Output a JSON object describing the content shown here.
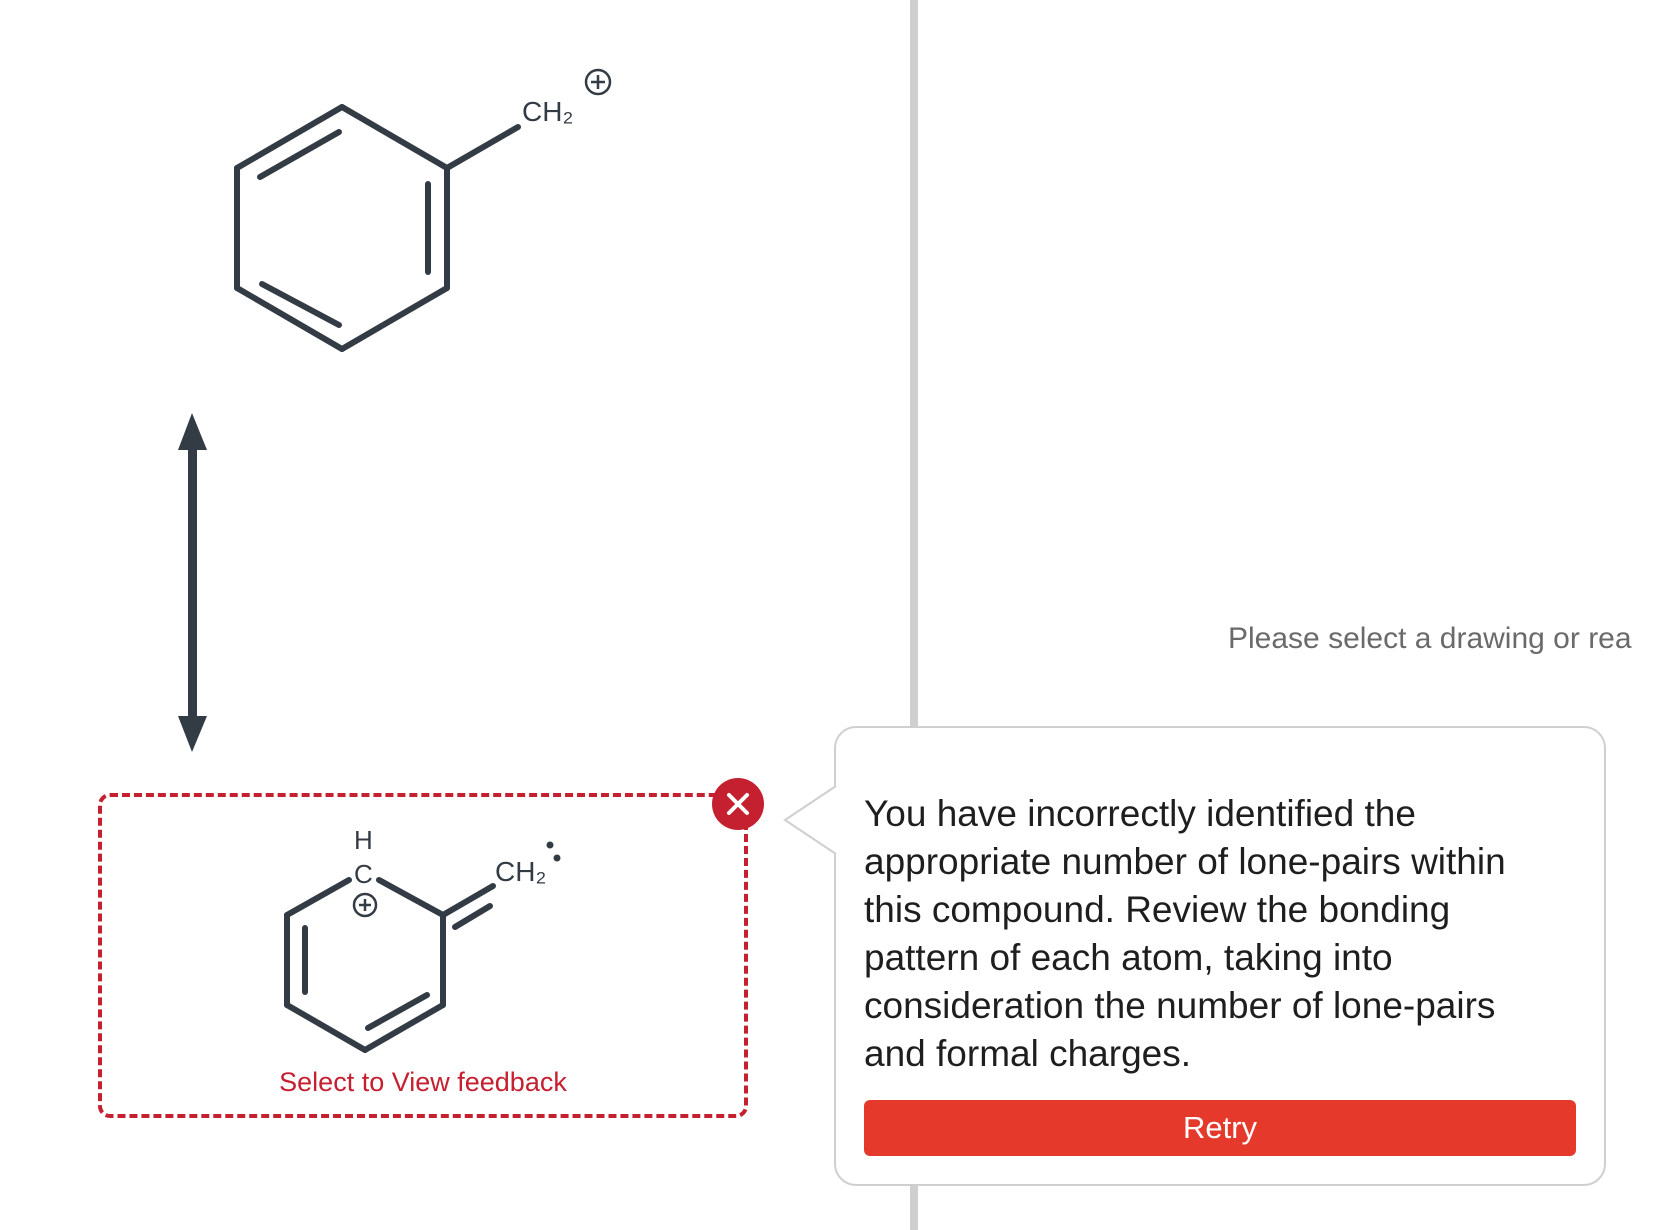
{
  "top_structure": {
    "group_label": "CH₂",
    "charge_symbol": "+"
  },
  "bottom_structure": {
    "h_label": "H",
    "c_label": "C",
    "group_label": "CH₂",
    "charge_symbol": "+",
    "lone_pair_symbol": ":"
  },
  "selection_box": {
    "link_text": "Select to View feedback"
  },
  "right_panel": {
    "hint_text": "Please select a drawing or rea"
  },
  "feedback_popover": {
    "message": "You have incorrectly identified the appropriate number of lone-pairs within this compound. Review the bonding pattern of each atom, taking into consideration the number of lone-pairs and formal charges.",
    "retry_label": "Retry"
  },
  "colors": {
    "bond": "#333b45",
    "error": "#c4202f",
    "retry_button": "#e53a2b",
    "divider": "#cfcfcf"
  },
  "icons": {
    "error": "close-x-icon",
    "resonance": "double-headed-arrow-icon"
  }
}
